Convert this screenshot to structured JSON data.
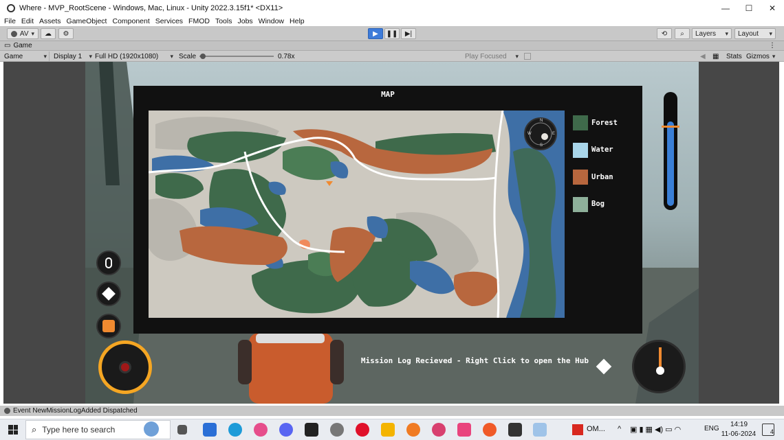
{
  "window": {
    "title": "Where - MVP_RootScene - Windows, Mac, Linux - Unity 2022.3.15f1* <DX11>",
    "minimize": "—",
    "maximize": "☐",
    "close": "✕"
  },
  "menu": [
    "File",
    "Edit",
    "Assets",
    "GameObject",
    "Component",
    "Services",
    "FMOD",
    "Tools",
    "Jobs",
    "Window",
    "Help"
  ],
  "toolbar": {
    "account": "AV",
    "layers": "Layers",
    "layout": "Layout"
  },
  "game_tab": {
    "label": "Game",
    "mode": "Game",
    "display": "Display 1",
    "resolution": "Full HD (1920x1080)",
    "scale_label": "Scale",
    "scale_value": "0.78x",
    "scale_fraction": 0.05,
    "play_focused": "Play Focused",
    "stats": "Stats",
    "gizmos": "Gizmos"
  },
  "game": {
    "map_title": "MAP",
    "legend": [
      {
        "label": "Forest",
        "color": "#3f6a4b"
      },
      {
        "label": "Water",
        "color": "#a9d6ea"
      },
      {
        "label": "Urban",
        "color": "#b8673e"
      },
      {
        "label": "Bog",
        "color": "#8eb09a"
      }
    ],
    "compass_letters": [
      "N",
      "E",
      "S",
      "W"
    ],
    "message": "Mission Log Recieved - Right Click to open the Hub",
    "stamina_level": 0.77
  },
  "status": {
    "text": "Event NewMissionLogAdded Dispatched"
  },
  "taskbar": {
    "search_placeholder": "Type here to search",
    "pinned_label": "OM...",
    "language": "ENG",
    "time": "14:19",
    "date": "11-06-2024",
    "notification_count": "4"
  },
  "colors": {
    "forest": "#3f6a4b",
    "water": "#3e6fa6",
    "urban": "#b8673e",
    "bog": "#7ea38b",
    "land": "#cdc9c0",
    "accent_play": "#3d7bd9",
    "hud_orange": "#f5a623"
  }
}
